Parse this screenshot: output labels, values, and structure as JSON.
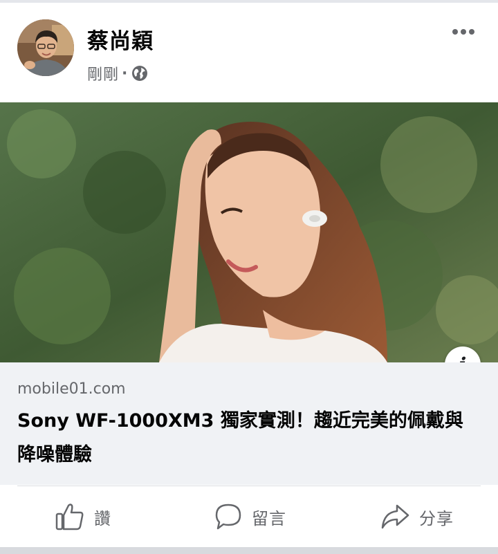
{
  "post": {
    "author": "蔡尚穎",
    "timestamp": "剛剛",
    "separator": "·",
    "audience_icon": "globe-icon",
    "more_icon": "more-options-icon"
  },
  "link": {
    "domain": "mobile01.com",
    "title": "Sony WF-1000XM3 獨家實測！趨近完美的佩戴與降噪體驗",
    "info_glyph": "i"
  },
  "actions": {
    "like_label": "讚",
    "comment_label": "留言",
    "share_label": "分享"
  },
  "colors": {
    "text_primary": "#050505",
    "text_secondary": "#65676b",
    "link_background": "#f0f2f5",
    "divider": "#dadde1"
  }
}
